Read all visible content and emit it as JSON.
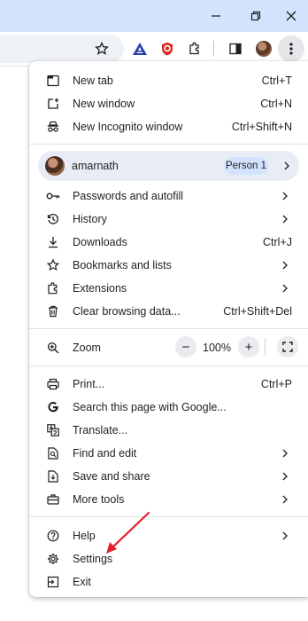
{
  "menu": {
    "top_items": [
      {
        "label": "New tab",
        "shortcut": "Ctrl+T",
        "icon": "new-tab-icon"
      },
      {
        "label": "New window",
        "shortcut": "Ctrl+N",
        "icon": "new-window-icon"
      },
      {
        "label": "New Incognito window",
        "shortcut": "Ctrl+Shift+N",
        "icon": "incognito-icon"
      }
    ],
    "profile": {
      "name": "amarnath",
      "badge": "Person 1"
    },
    "group2": [
      {
        "label": "Passwords and autofill",
        "icon": "key-icon"
      },
      {
        "label": "History",
        "icon": "history-icon"
      },
      {
        "label": "Downloads",
        "shortcut": "Ctrl+J",
        "icon": "download-icon"
      },
      {
        "label": "Bookmarks and lists",
        "icon": "star-icon"
      },
      {
        "label": "Extensions",
        "icon": "puzzle-icon"
      },
      {
        "label": "Clear browsing data...",
        "shortcut": "Ctrl+Shift+Del",
        "icon": "trash-icon"
      }
    ],
    "zoom": {
      "label": "Zoom",
      "value": "100%",
      "minus": "−",
      "plus": "+"
    },
    "group3": [
      {
        "label": "Print...",
        "shortcut": "Ctrl+P",
        "icon": "printer-icon"
      },
      {
        "label": "Search this page with Google...",
        "icon": "google-icon"
      },
      {
        "label": "Translate...",
        "icon": "translate-icon"
      },
      {
        "label": "Find and edit",
        "icon": "find-icon"
      },
      {
        "label": "Save and share",
        "icon": "save-share-icon"
      },
      {
        "label": "More tools",
        "icon": "toolbox-icon"
      }
    ],
    "group4": [
      {
        "label": "Help",
        "icon": "help-icon"
      },
      {
        "label": "Settings",
        "icon": "gear-icon"
      },
      {
        "label": "Exit",
        "icon": "exit-icon"
      }
    ]
  },
  "annotation": {
    "color": "#e5202e",
    "points_to": "Settings"
  },
  "colors": {
    "titlebar": "#d3e3fd",
    "menu_bg": "#ffffff",
    "badge_bg": "#d3e3fd"
  }
}
